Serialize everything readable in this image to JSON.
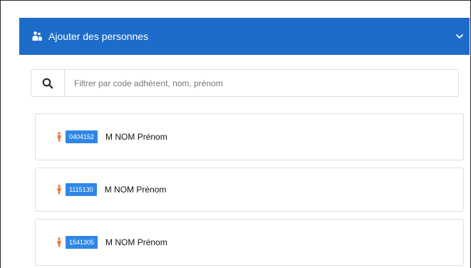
{
  "panel": {
    "title": "Ajouter des personnes",
    "header_color": "#1d6cc9",
    "icon": "users-icon"
  },
  "search": {
    "placeholder": "Filtrer par code adhérent, nom, prénom",
    "value": "",
    "icon": "search-icon"
  },
  "people": [
    {
      "code": "0404152",
      "name": "M NOM Prénom",
      "icon": "person-icon"
    },
    {
      "code": "1115130",
      "name": "M NOM Prénom",
      "icon": "person-icon"
    },
    {
      "code": "1541305",
      "name": "M NOM Prénom",
      "icon": "person-icon"
    }
  ],
  "colors": {
    "badge": "#2f86e5",
    "person_icon": "#f07a3a"
  }
}
